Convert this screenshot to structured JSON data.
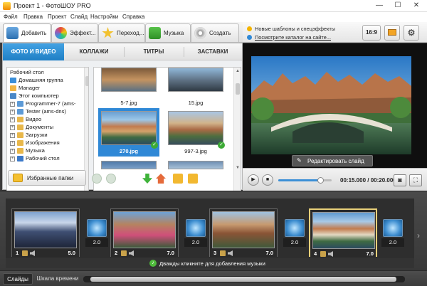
{
  "window": {
    "title": "Проект 1 - ФотоШОУ PRO",
    "minimize": "—",
    "maximize": "☐",
    "close": "✕"
  },
  "menu": [
    "Файл",
    "Правка",
    "Проект",
    "Слайд",
    "Настройки",
    "Справка"
  ],
  "toolbar": {
    "tabs": [
      "Добавить",
      "Эффект...",
      "Переход...",
      "Музыка",
      "Создать"
    ]
  },
  "subtabs": [
    "ФОТО И ВИДЕО",
    "КОЛЛАЖИ",
    "ТИТРЫ",
    "ЗАСТАВКИ"
  ],
  "tree": [
    {
      "label": "Рабочий стол",
      "icon_color": "#3b79c9"
    },
    {
      "label": "Домашняя группа",
      "icon_color": "#3a8ed8"
    },
    {
      "label": "Manager",
      "icon_color": "#f0b545"
    },
    {
      "label": "Этот компьютер",
      "icon_color": "#4a88c7"
    },
    {
      "label": "Programmer-7 (ams-",
      "icon_color": "#5c9ad6"
    },
    {
      "label": "Tester (ams-dns)",
      "icon_color": "#5c9ad6"
    },
    {
      "label": "Видео",
      "icon_color": "#e8b74a"
    },
    {
      "label": "Документы",
      "icon_color": "#e8b74a"
    },
    {
      "label": "Загрузки",
      "icon_color": "#e8b74a"
    },
    {
      "label": "Изображения",
      "icon_color": "#e8b74a"
    },
    {
      "label": "Музыка",
      "icon_color": "#e8b74a"
    },
    {
      "label": "Рабочий стол",
      "icon_color": "#3b79c9"
    }
  ],
  "thumbnails": [
    {
      "caption": "5-7.jpg",
      "checked": false,
      "selected": false
    },
    {
      "caption": "15.jpg",
      "checked": false,
      "selected": false
    },
    {
      "caption": "270.jpg",
      "checked": true,
      "selected": true
    },
    {
      "caption": "997-3.jpg",
      "checked": true,
      "selected": false
    }
  ],
  "favorites_label": "Избранные папки",
  "promo": {
    "line1": "Новые шаблоны и спецэффекты",
    "line2": "Посмотрите каталог на сайте..."
  },
  "aspect_label": "16:9",
  "edit_slide_label": "Редактировать слайд",
  "player": {
    "time": "00:15.000 / 00:20.000",
    "progress": 0.78
  },
  "slides": [
    {
      "num": "1",
      "duration": "5.0",
      "selected": false
    },
    {
      "num": "2",
      "duration": "7.0",
      "selected": false
    },
    {
      "num": "3",
      "duration": "7.0",
      "selected": false
    },
    {
      "num": "4",
      "duration": "7.0",
      "selected": true
    }
  ],
  "transitions": [
    "2.0",
    "2.0",
    "2.0",
    "2.0"
  ],
  "music_hint": "Дважды кликните для добавления музыки",
  "bottom_tabs": [
    "Слайды",
    "Шкала времени"
  ],
  "colors": {
    "accent": "#2f88d6",
    "selection_border": "#e8d079",
    "check": "#3dab36"
  }
}
